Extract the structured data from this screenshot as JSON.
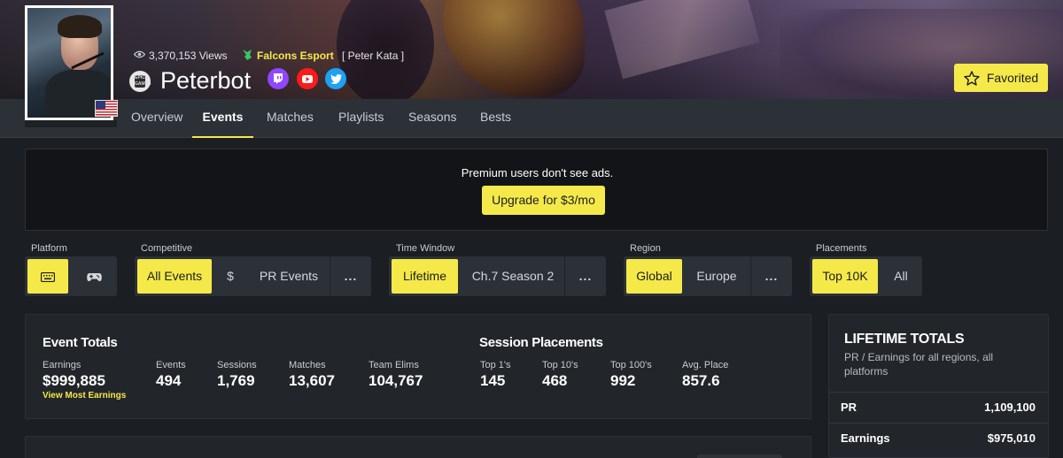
{
  "profile": {
    "views": "3,370,153 Views",
    "team": "Falcons Esport",
    "real_name": "[ Peter Kata ]",
    "player_name": "Peterbot",
    "platform_icon": "epic-games-icon",
    "country_flag": "us-flag",
    "socials": [
      {
        "name": "twitch",
        "icon": "twitch-icon",
        "color": "#9146ff"
      },
      {
        "name": "youtube",
        "icon": "youtube-icon",
        "color": "#ff1a1a"
      },
      {
        "name": "twitter",
        "icon": "twitter-icon",
        "color": "#1da1f2"
      }
    ],
    "favorite_label": "Favorited"
  },
  "nav": {
    "tabs": [
      "Overview",
      "Events",
      "Matches",
      "Playlists",
      "Seasons",
      "Bests"
    ],
    "active": "Events"
  },
  "ad": {
    "text": "Premium users don't see ads.",
    "button": "Upgrade for $3/mo"
  },
  "filters": {
    "platform": {
      "label": "Platform",
      "options": [
        "keyboard-icon",
        "controller-icon"
      ],
      "selected": "keyboard-icon"
    },
    "competitive": {
      "label": "Competitive",
      "options": [
        "All Events",
        "$",
        "PR Events",
        "..."
      ],
      "selected": "All Events"
    },
    "time_window": {
      "label": "Time Window",
      "options": [
        "Lifetime",
        "Ch.7 Season 2",
        "..."
      ],
      "selected": "Lifetime"
    },
    "region": {
      "label": "Region",
      "options": [
        "Global",
        "Europe",
        "..."
      ],
      "selected": "Global"
    },
    "placements": {
      "label": "Placements",
      "options": [
        "Top 10K",
        "All"
      ],
      "selected": "Top 10K"
    }
  },
  "event_totals": {
    "title": "Event Totals",
    "stats": [
      {
        "label": "Earnings",
        "value": "$999,885"
      },
      {
        "label": "Events",
        "value": "494"
      },
      {
        "label": "Sessions",
        "value": "1,769"
      },
      {
        "label": "Matches",
        "value": "13,607"
      },
      {
        "label": "Team Elims",
        "value": "104,767"
      }
    ],
    "link": "View Most Earnings"
  },
  "session_placements": {
    "title": "Session Placements",
    "stats": [
      {
        "label": "Top 1's",
        "value": "145"
      },
      {
        "label": "Top 10's",
        "value": "468"
      },
      {
        "label": "Top 100's",
        "value": "992"
      },
      {
        "label": "Avg. Place",
        "value": "857.6"
      }
    ]
  },
  "lifetime": {
    "title": "LIFETIME TOTALS",
    "subtitle": "PR / Earnings for all regions, all platforms",
    "rows": [
      {
        "label": "PR",
        "value": "1,109,100"
      },
      {
        "label": "Earnings",
        "value": "$975,010"
      }
    ]
  },
  "colors": {
    "accent": "#f5e94a",
    "background": "#1b1e22",
    "panel": "#22262b",
    "nav": "#2c3138"
  }
}
